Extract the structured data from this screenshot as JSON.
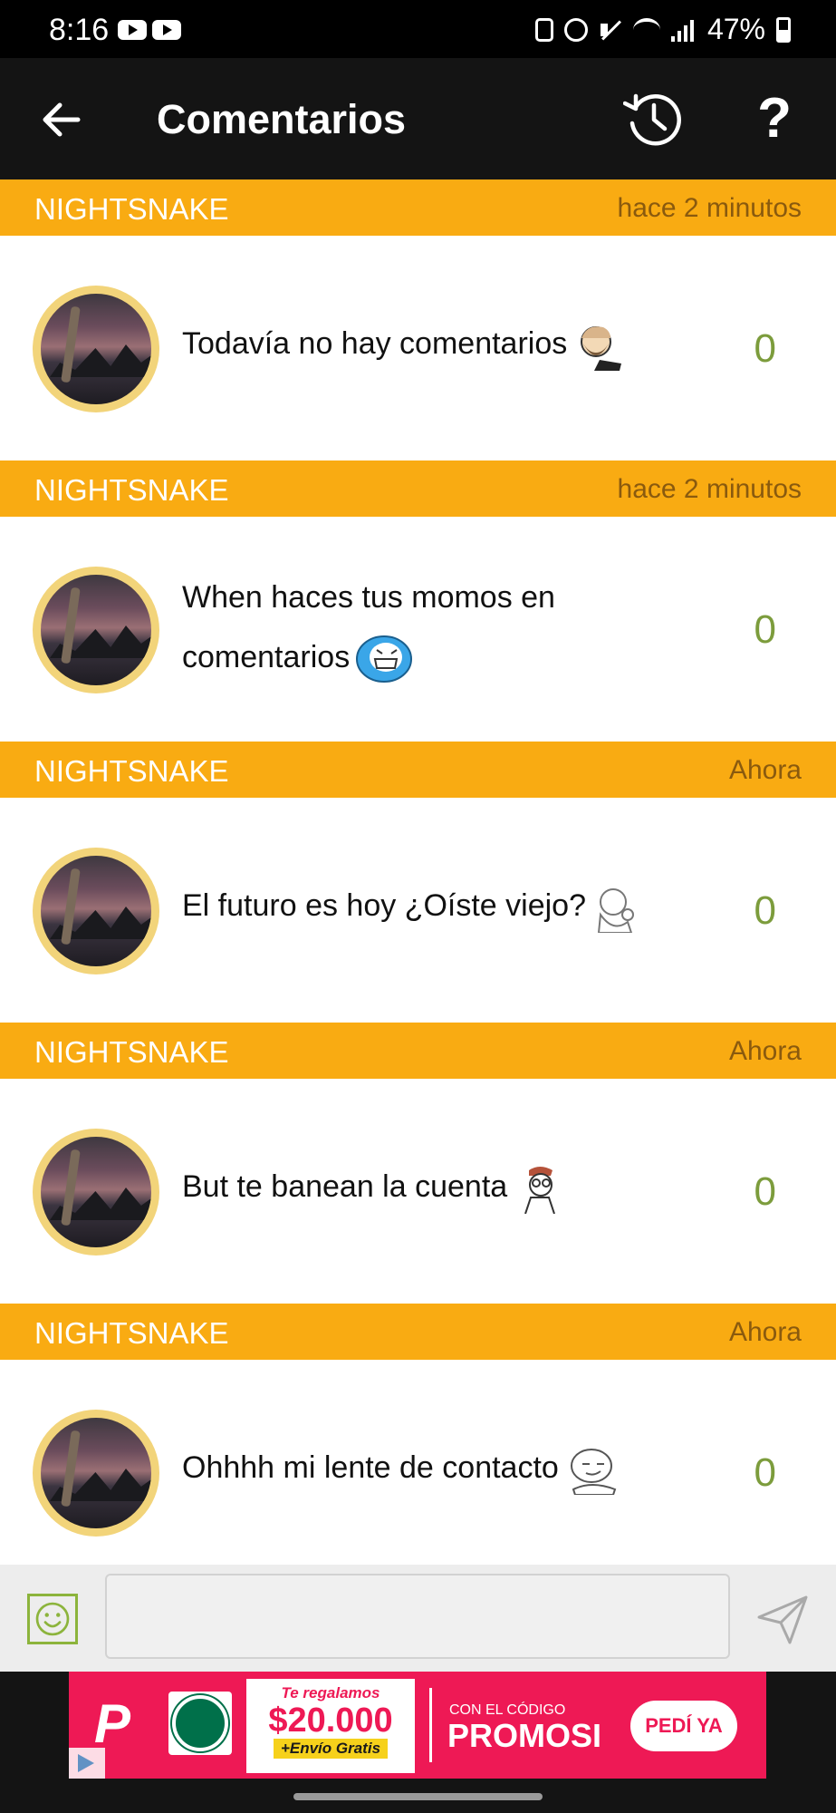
{
  "status_bar": {
    "time": "8:16",
    "battery": "47%"
  },
  "app_bar": {
    "title": "Comentarios"
  },
  "comments": [
    {
      "username": "NIGHTSNAKE",
      "timestamp": "hace 2 minutos",
      "text": "Todavía no hay comentarios",
      "votes": "0",
      "emoji": "chad-meme-icon"
    },
    {
      "username": "NIGHTSNAKE",
      "timestamp": "hace 2 minutos",
      "text": "When haces tus momos en comentarios",
      "votes": "0",
      "emoji": "i-lied-meme-icon"
    },
    {
      "username": "NIGHTSNAKE",
      "timestamp": "Ahora",
      "text": "El futuro es hoy ¿Oíste viejo?",
      "votes": "0",
      "emoji": "thinking-meme-icon"
    },
    {
      "username": "NIGHTSNAKE",
      "timestamp": "Ahora",
      "text": "But te banean la cuenta",
      "votes": "0",
      "emoji": "nerd-meme-icon"
    },
    {
      "username": "NIGHTSNAKE",
      "timestamp": "Ahora",
      "text": "Ohhhh mi lente de contacto",
      "votes": "0",
      "emoji": "smug-meme-icon"
    }
  ],
  "input": {
    "placeholder": ""
  },
  "ad": {
    "card_top": "Te regalamos",
    "card_amount": "$20.000",
    "card_bottom": "+Envío Gratis",
    "code_label": "CON EL CÓDIGO",
    "code": "PROMOSI",
    "cta": "PEDÍ YA"
  },
  "colors": {
    "header_bar": "#f9ab12",
    "vote": "#7c9c3c",
    "emoji_button": "#8cb43c",
    "ad": "#ee1955"
  }
}
